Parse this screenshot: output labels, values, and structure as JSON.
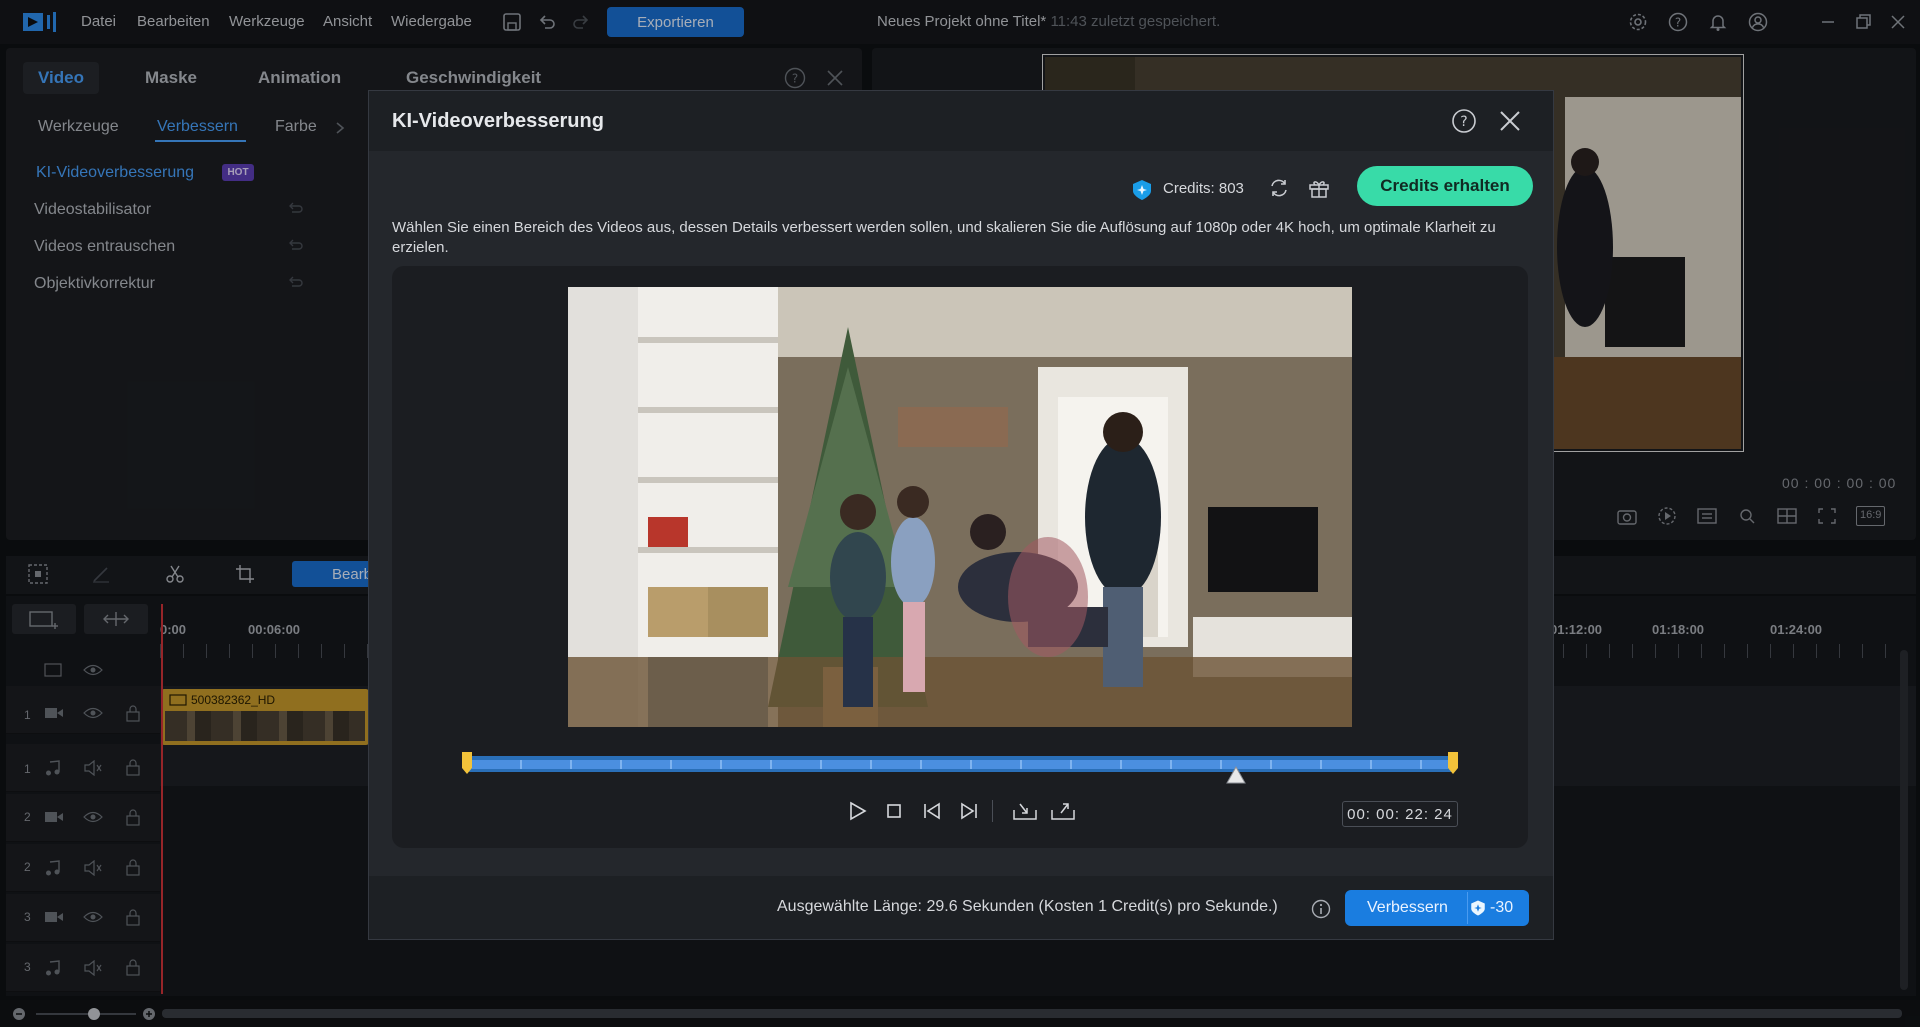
{
  "menu": {
    "items": [
      "Datei",
      "Bearbeiten",
      "Werkzeuge",
      "Ansicht",
      "Wiedergabe"
    ],
    "export_label": "Exportieren",
    "project_title": "Neues Projekt ohne Titel*",
    "saved_status": "11:43 zuletzt gespeichert."
  },
  "left_panel": {
    "tabs": [
      "Video",
      "Maske",
      "Animation",
      "Geschwindigkeit"
    ],
    "subtabs": [
      "Werkzeuge",
      "Verbessern",
      "Farbe"
    ],
    "items": [
      "KI-Videoverbesserung",
      "Videostabilisator",
      "Videos entrauschen",
      "Objektivkorrektur"
    ],
    "hot_badge": "HOT"
  },
  "preview": {
    "timecode": "00 : 00 : 00 : 00",
    "aspect": "16:9"
  },
  "timeline": {
    "toolbar_button": "Bearb",
    "ruler_labels": [
      "0:00",
      "00:06:00",
      "01:12:00",
      "01:18:00",
      "01:24:00"
    ],
    "track_numbers": [
      "1",
      "1",
      "2",
      "2",
      "3",
      "3"
    ],
    "clip_name": "500382362_HD"
  },
  "modal": {
    "title": "KI-Videoverbesserung",
    "credits_label": "Credits: 803",
    "get_credits": "Credits erhalten",
    "description": "Wählen Sie einen Bereich des Videos aus, dessen Details verbessert werden sollen, und skalieren Sie die Auflösung auf 1080p oder 4K hoch, um optimale Klarheit zu erzielen.",
    "timecode": "00: 00: 22: 24",
    "selected_length": "Ausgewählte Länge: 29.6 Sekunden (Kosten 1 Credit(s) pro Sekunde.)",
    "enhance_label": "Verbessern",
    "enhance_cost": "-30",
    "selection_range": [
      0,
      1
    ],
    "playhead_position": 0.78
  },
  "colors": {
    "accent": "#1a6fd1",
    "credits_button": "#38dba8",
    "hot_badge": "#5e3fb8",
    "clip": "#c89a2c"
  }
}
